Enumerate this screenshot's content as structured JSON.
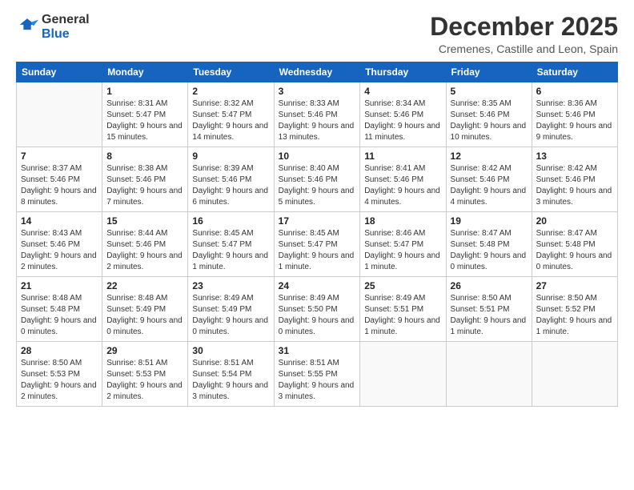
{
  "logo": {
    "line1": "General",
    "line2": "Blue"
  },
  "title": "December 2025",
  "location": "Cremenes, Castille and Leon, Spain",
  "days_of_week": [
    "Sunday",
    "Monday",
    "Tuesday",
    "Wednesday",
    "Thursday",
    "Friday",
    "Saturday"
  ],
  "weeks": [
    [
      {
        "day": "",
        "sunrise": "",
        "sunset": "",
        "daylight": ""
      },
      {
        "day": "1",
        "sunrise": "Sunrise: 8:31 AM",
        "sunset": "Sunset: 5:47 PM",
        "daylight": "Daylight: 9 hours and 15 minutes."
      },
      {
        "day": "2",
        "sunrise": "Sunrise: 8:32 AM",
        "sunset": "Sunset: 5:47 PM",
        "daylight": "Daylight: 9 hours and 14 minutes."
      },
      {
        "day": "3",
        "sunrise": "Sunrise: 8:33 AM",
        "sunset": "Sunset: 5:46 PM",
        "daylight": "Daylight: 9 hours and 13 minutes."
      },
      {
        "day": "4",
        "sunrise": "Sunrise: 8:34 AM",
        "sunset": "Sunset: 5:46 PM",
        "daylight": "Daylight: 9 hours and 11 minutes."
      },
      {
        "day": "5",
        "sunrise": "Sunrise: 8:35 AM",
        "sunset": "Sunset: 5:46 PM",
        "daylight": "Daylight: 9 hours and 10 minutes."
      },
      {
        "day": "6",
        "sunrise": "Sunrise: 8:36 AM",
        "sunset": "Sunset: 5:46 PM",
        "daylight": "Daylight: 9 hours and 9 minutes."
      }
    ],
    [
      {
        "day": "7",
        "sunrise": "Sunrise: 8:37 AM",
        "sunset": "Sunset: 5:46 PM",
        "daylight": "Daylight: 9 hours and 8 minutes."
      },
      {
        "day": "8",
        "sunrise": "Sunrise: 8:38 AM",
        "sunset": "Sunset: 5:46 PM",
        "daylight": "Daylight: 9 hours and 7 minutes."
      },
      {
        "day": "9",
        "sunrise": "Sunrise: 8:39 AM",
        "sunset": "Sunset: 5:46 PM",
        "daylight": "Daylight: 9 hours and 6 minutes."
      },
      {
        "day": "10",
        "sunrise": "Sunrise: 8:40 AM",
        "sunset": "Sunset: 5:46 PM",
        "daylight": "Daylight: 9 hours and 5 minutes."
      },
      {
        "day": "11",
        "sunrise": "Sunrise: 8:41 AM",
        "sunset": "Sunset: 5:46 PM",
        "daylight": "Daylight: 9 hours and 4 minutes."
      },
      {
        "day": "12",
        "sunrise": "Sunrise: 8:42 AM",
        "sunset": "Sunset: 5:46 PM",
        "daylight": "Daylight: 9 hours and 4 minutes."
      },
      {
        "day": "13",
        "sunrise": "Sunrise: 8:42 AM",
        "sunset": "Sunset: 5:46 PM",
        "daylight": "Daylight: 9 hours and 3 minutes."
      }
    ],
    [
      {
        "day": "14",
        "sunrise": "Sunrise: 8:43 AM",
        "sunset": "Sunset: 5:46 PM",
        "daylight": "Daylight: 9 hours and 2 minutes."
      },
      {
        "day": "15",
        "sunrise": "Sunrise: 8:44 AM",
        "sunset": "Sunset: 5:46 PM",
        "daylight": "Daylight: 9 hours and 2 minutes."
      },
      {
        "day": "16",
        "sunrise": "Sunrise: 8:45 AM",
        "sunset": "Sunset: 5:47 PM",
        "daylight": "Daylight: 9 hours and 1 minute."
      },
      {
        "day": "17",
        "sunrise": "Sunrise: 8:45 AM",
        "sunset": "Sunset: 5:47 PM",
        "daylight": "Daylight: 9 hours and 1 minute."
      },
      {
        "day": "18",
        "sunrise": "Sunrise: 8:46 AM",
        "sunset": "Sunset: 5:47 PM",
        "daylight": "Daylight: 9 hours and 1 minute."
      },
      {
        "day": "19",
        "sunrise": "Sunrise: 8:47 AM",
        "sunset": "Sunset: 5:48 PM",
        "daylight": "Daylight: 9 hours and 0 minutes."
      },
      {
        "day": "20",
        "sunrise": "Sunrise: 8:47 AM",
        "sunset": "Sunset: 5:48 PM",
        "daylight": "Daylight: 9 hours and 0 minutes."
      }
    ],
    [
      {
        "day": "21",
        "sunrise": "Sunrise: 8:48 AM",
        "sunset": "Sunset: 5:48 PM",
        "daylight": "Daylight: 9 hours and 0 minutes."
      },
      {
        "day": "22",
        "sunrise": "Sunrise: 8:48 AM",
        "sunset": "Sunset: 5:49 PM",
        "daylight": "Daylight: 9 hours and 0 minutes."
      },
      {
        "day": "23",
        "sunrise": "Sunrise: 8:49 AM",
        "sunset": "Sunset: 5:49 PM",
        "daylight": "Daylight: 9 hours and 0 minutes."
      },
      {
        "day": "24",
        "sunrise": "Sunrise: 8:49 AM",
        "sunset": "Sunset: 5:50 PM",
        "daylight": "Daylight: 9 hours and 0 minutes."
      },
      {
        "day": "25",
        "sunrise": "Sunrise: 8:49 AM",
        "sunset": "Sunset: 5:51 PM",
        "daylight": "Daylight: 9 hours and 1 minute."
      },
      {
        "day": "26",
        "sunrise": "Sunrise: 8:50 AM",
        "sunset": "Sunset: 5:51 PM",
        "daylight": "Daylight: 9 hours and 1 minute."
      },
      {
        "day": "27",
        "sunrise": "Sunrise: 8:50 AM",
        "sunset": "Sunset: 5:52 PM",
        "daylight": "Daylight: 9 hours and 1 minute."
      }
    ],
    [
      {
        "day": "28",
        "sunrise": "Sunrise: 8:50 AM",
        "sunset": "Sunset: 5:53 PM",
        "daylight": "Daylight: 9 hours and 2 minutes."
      },
      {
        "day": "29",
        "sunrise": "Sunrise: 8:51 AM",
        "sunset": "Sunset: 5:53 PM",
        "daylight": "Daylight: 9 hours and 2 minutes."
      },
      {
        "day": "30",
        "sunrise": "Sunrise: 8:51 AM",
        "sunset": "Sunset: 5:54 PM",
        "daylight": "Daylight: 9 hours and 3 minutes."
      },
      {
        "day": "31",
        "sunrise": "Sunrise: 8:51 AM",
        "sunset": "Sunset: 5:55 PM",
        "daylight": "Daylight: 9 hours and 3 minutes."
      },
      {
        "day": "",
        "sunrise": "",
        "sunset": "",
        "daylight": ""
      },
      {
        "day": "",
        "sunrise": "",
        "sunset": "",
        "daylight": ""
      },
      {
        "day": "",
        "sunrise": "",
        "sunset": "",
        "daylight": ""
      }
    ]
  ],
  "accent_color": "#1565c0"
}
